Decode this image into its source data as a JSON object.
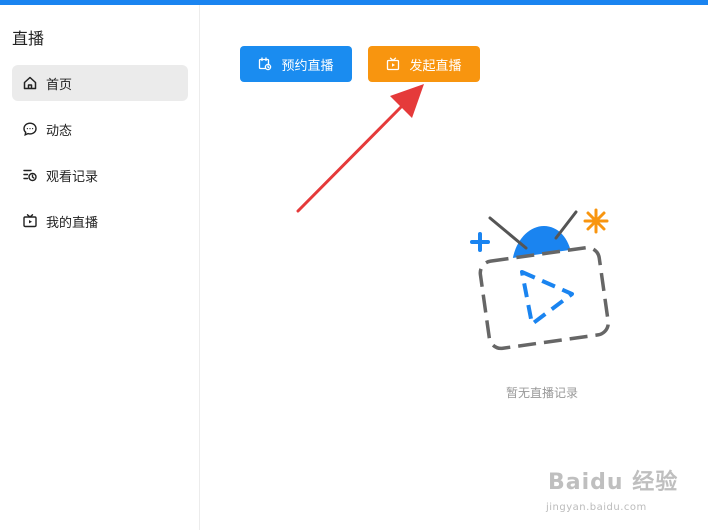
{
  "colors": {
    "top_bar": "#1a84f0",
    "primary_blue": "#1a8cf0",
    "primary_orange": "#f8950f",
    "arrow_red": "#e53a3a",
    "sidebar_active_bg": "#ebebeb"
  },
  "sidebar": {
    "title": "直播",
    "items": [
      {
        "label": "首页",
        "icon": "home-icon",
        "active": true
      },
      {
        "label": "动态",
        "icon": "chat-bubble-icon",
        "active": false
      },
      {
        "label": "观看记录",
        "icon": "watch-history-icon",
        "active": false
      },
      {
        "label": "我的直播",
        "icon": "tv-icon",
        "active": false
      }
    ]
  },
  "toolbar": {
    "schedule_label": "预约直播",
    "schedule_icon": "calendar-clock-icon",
    "start_label": "发起直播",
    "start_icon": "tv-play-icon"
  },
  "main": {
    "empty_state_text": "暂无直播记录",
    "empty_state_icon": "tv-play-illustration-icon"
  },
  "watermark": {
    "brand": "Baidu 经验",
    "url": "jingyan.baidu.com"
  }
}
